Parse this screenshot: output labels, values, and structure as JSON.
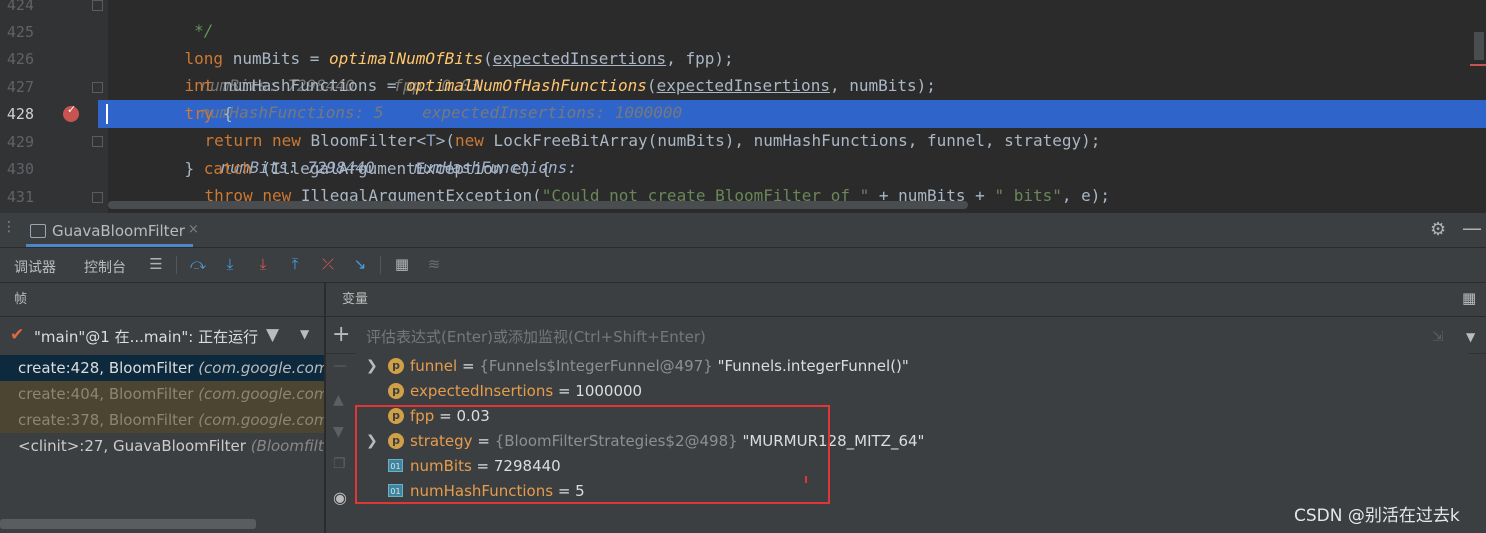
{
  "editor": {
    "lines": [
      {
        "num": "424",
        "type": "comment",
        "text": " */"
      },
      {
        "num": "425"
      },
      {
        "num": "426"
      },
      {
        "num": "427"
      },
      {
        "num": "428"
      },
      {
        "num": "429"
      },
      {
        "num": "430"
      },
      {
        "num": "431",
        "text": "}"
      }
    ],
    "l425": {
      "kw": "long",
      "rest1": " numBits = ",
      "fn": "optimalNumOfBits",
      "p1": "(",
      "arg1": "expectedInsertions",
      "p2": ", fpp);",
      "hint": "numBits: 7298440    fpp: 0.03"
    },
    "l426": {
      "kw": "int",
      "rest1": " numHashFunctions = ",
      "fn": "optimalNumOfHashFunctions",
      "p1": "(",
      "arg1": "expectedInsertions",
      "p2": ", numBits);",
      "hint": "numHashFunctions: 5    expectedInsertions: 1000000"
    },
    "l427": {
      "kw": "try",
      "rest": " {"
    },
    "l428": {
      "kw1": "return",
      "kw2": "new",
      "t1": " BloomFilter<",
      "t2": ">(",
      "kw3": "new",
      "t3": " LockFreeBitArray(numBits), numHashFunctions, funnel, strategy);",
      "hint": "numBits: 7298440    numHashFunctions:"
    },
    "l429": {
      "t1": "} ",
      "kw": "catch",
      "t2": " (IllegalArgumentException e) {"
    },
    "l430": {
      "kw1": "throw",
      "kw2": "new",
      "t1": " IllegalArgumentException(",
      "str1": "\"Could not create BloomFilter of \"",
      "t2": " + numBits + ",
      "str2": "\" bits\"",
      "t3": ", e);"
    }
  },
  "debug": {
    "tab_label": "GuavaBloomFilter",
    "tab_close": "×",
    "toolbar": {
      "debugger_label": "调试器",
      "console_label": "控制台"
    },
    "frames_header": "帧",
    "vars_header": "变量",
    "thread": {
      "text": "\"main\"@1 在...main\": 正在运行"
    },
    "frames": [
      {
        "method": "create:428, BloomFilter ",
        "pkg": "(com.google.com",
        "state": "selected"
      },
      {
        "method": "create:404, BloomFilter ",
        "pkg": "(com.google.com",
        "state": "library"
      },
      {
        "method": "create:378, BloomFilter ",
        "pkg": "(com.google.com",
        "state": "library"
      },
      {
        "method": "<clinit>:27, GuavaBloomFilter ",
        "pkg": "(Bloomfilter",
        "state": "normal"
      }
    ],
    "eval_placeholder": "评估表达式(Enter)或添加监视(Ctrl+Shift+Enter)",
    "variables": [
      {
        "name": "funnel",
        "eq": " = ",
        "type": "{Funnels$IntegerFunnel@497} ",
        "value": "\"Funnels.integerFunnel()\"",
        "badge": "p",
        "expandable": true
      },
      {
        "name": "expectedInsertions",
        "eq": " = ",
        "type": "",
        "value": "1000000",
        "badge": "p",
        "expandable": false
      },
      {
        "name": "fpp",
        "eq": " = ",
        "type": "",
        "value": "0.03",
        "badge": "p",
        "expandable": false
      },
      {
        "name": "strategy",
        "eq": " = ",
        "type": "{BloomFilterStrategies$2@498} ",
        "value": "\"MURMUR128_MITZ_64\"",
        "badge": "p",
        "expandable": true
      },
      {
        "name": "numBits",
        "eq": " = ",
        "type": "",
        "value": "7298440",
        "badge": "01",
        "expandable": false
      },
      {
        "name": "numHashFunctions",
        "eq": " = ",
        "type": "",
        "value": "5",
        "badge": "01",
        "expandable": false
      }
    ]
  },
  "watermark": "CSDN @别活在过去k",
  "colors": {
    "keyword": "#cc7832",
    "method": "#ffc66d",
    "string": "#6a8759",
    "selection": "#2f65ca",
    "highlight_box": "#e13636"
  }
}
